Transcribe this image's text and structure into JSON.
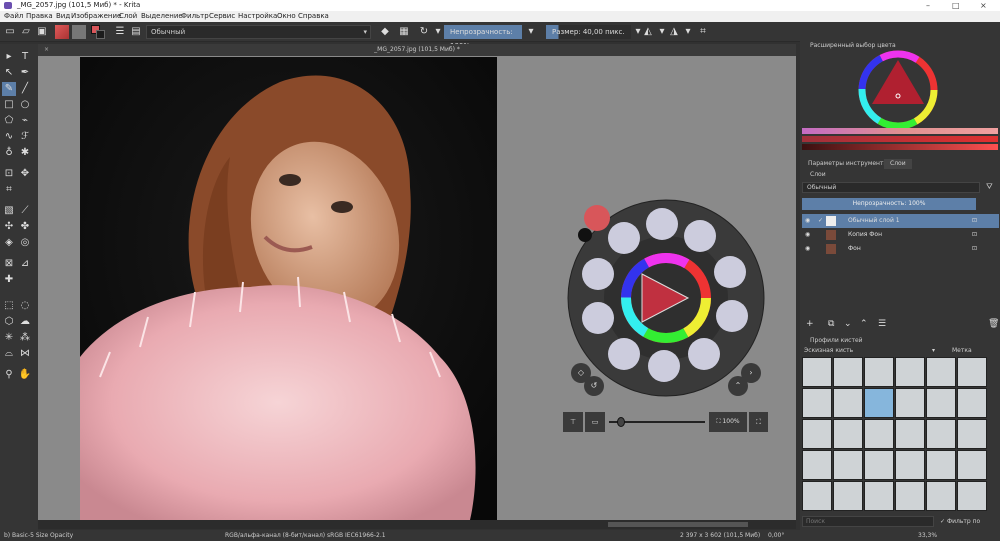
{
  "window": {
    "title": "_MG_2057.jpg (101,5 Миб) * - Krita"
  },
  "menu": [
    "Файл",
    "Правка",
    "Вид",
    "Изображение",
    "Слой",
    "Выделение",
    "Фильтр",
    "Сервис",
    "Настройка",
    "Окно",
    "Справка"
  ],
  "toolbar": {
    "blend_mode": "Обычный",
    "opacity_label": "Непрозрачность: 100%",
    "size_label": "Размер: 40,00 пикс.",
    "fg_color": "#d8565a",
    "bg_color": "#1c1c1c"
  },
  "document": {
    "tab_title": "_MG_2057.jpg (101,5 Миб) *"
  },
  "popup_palette": {
    "zoom_label": "100%",
    "fg_color": "#d8565a"
  },
  "color_selector": {
    "title": "Расширенный выбор цвета"
  },
  "tool_options_tabs": [
    "Параметры инструмента",
    "Слои"
  ],
  "layers": {
    "title": "Слои",
    "blend_mode": "Обычный",
    "opacity_label": "Непрозрачность: 100%",
    "items": [
      {
        "name": "Обычный слой 1",
        "selected": true
      },
      {
        "name": "Копия Фон",
        "selected": false
      },
      {
        "name": "Фон",
        "selected": false
      }
    ]
  },
  "brush_presets": {
    "title": "Профили кистей",
    "current_tag": "Эскизная кисть",
    "tag_label": "Метка",
    "search_placeholder": "Поиск",
    "filter_label": "Фильтр по метке"
  },
  "status": {
    "brush": "b) Basic-5 Size Opacity",
    "colorspace": "RGB/альфа-канал (8-бит/канал)  sRGB IEC61966-2.1",
    "dimensions": "2 397 х 3 602 (101,5 Миб)",
    "rotation": "0,00°",
    "zoom": "33,3%"
  }
}
